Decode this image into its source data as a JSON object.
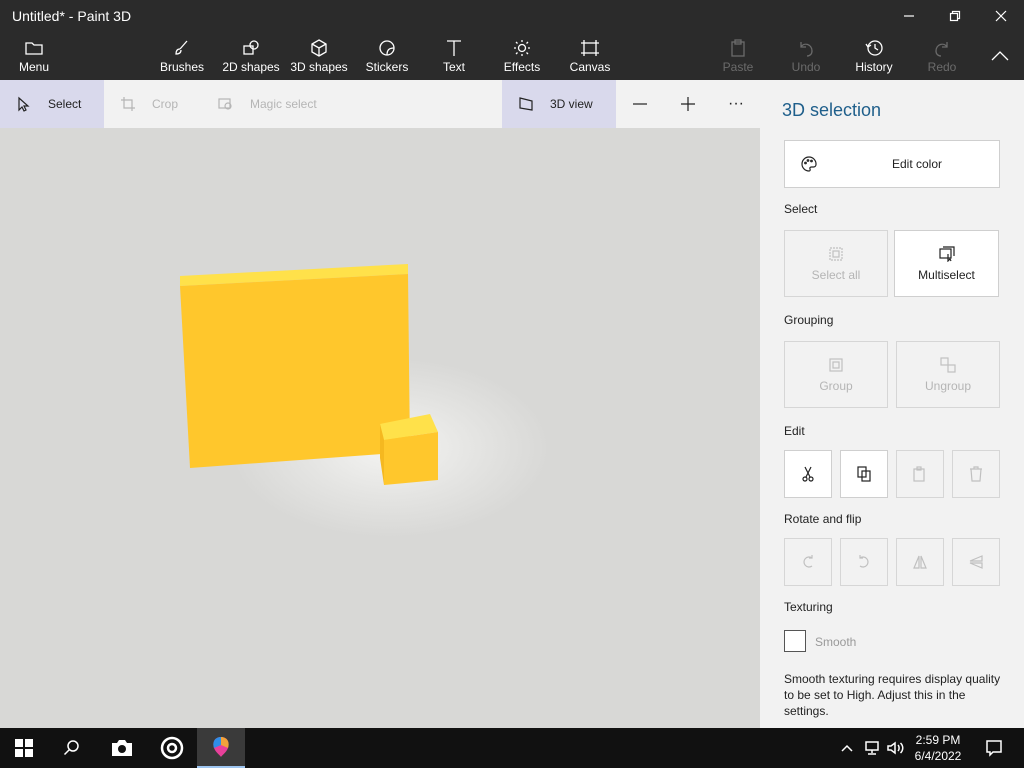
{
  "window": {
    "title": "Untitled* - Paint 3D"
  },
  "ribbon": {
    "menu": "Menu",
    "brushes": "Brushes",
    "shapes2d": "2D shapes",
    "shapes3d": "3D shapes",
    "stickers": "Stickers",
    "text": "Text",
    "effects": "Effects",
    "canvas": "Canvas",
    "paste": "Paste",
    "undo": "Undo",
    "history": "History",
    "redo": "Redo"
  },
  "toolbar": {
    "select": "Select",
    "crop": "Crop",
    "magic_select": "Magic select",
    "view3d": "3D view",
    "more": "···"
  },
  "panel": {
    "title": "3D selection",
    "edit_color": "Edit color",
    "select_section": "Select",
    "select_all": "Select all",
    "multiselect": "Multiselect",
    "grouping_section": "Grouping",
    "group": "Group",
    "ungroup": "Ungroup",
    "edit_section": "Edit",
    "rotate_section": "Rotate and flip",
    "texturing_section": "Texturing",
    "smooth": "Smooth",
    "note": "Smooth texturing requires display quality to be set to High. Adjust this in the settings."
  },
  "canvas": {
    "object_color": "#FFC72C"
  },
  "taskbar": {
    "time": "2:59 PM",
    "date": "6/4/2022"
  }
}
